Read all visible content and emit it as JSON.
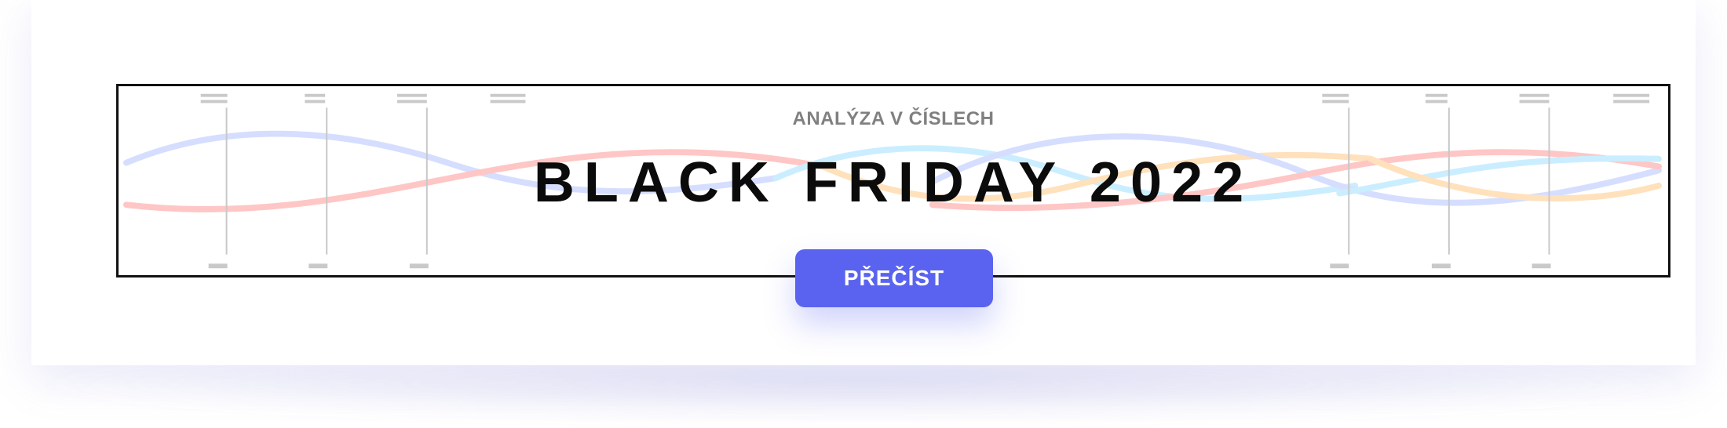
{
  "banner": {
    "subtitle": "ANALÝZA V ČÍSLECH",
    "title": "BLACK FRIDAY 2022"
  },
  "cta": {
    "label": "PŘEČÍST"
  },
  "colors": {
    "accent": "#5a63f0",
    "border": "#111111",
    "subtitle": "#808080",
    "title": "#0b0b0b",
    "wave_blue": "#c9d3ff",
    "wave_red": "#ffb3b3",
    "wave_orange": "#ffd7a6",
    "wave_cyan": "#b9e9ff"
  }
}
